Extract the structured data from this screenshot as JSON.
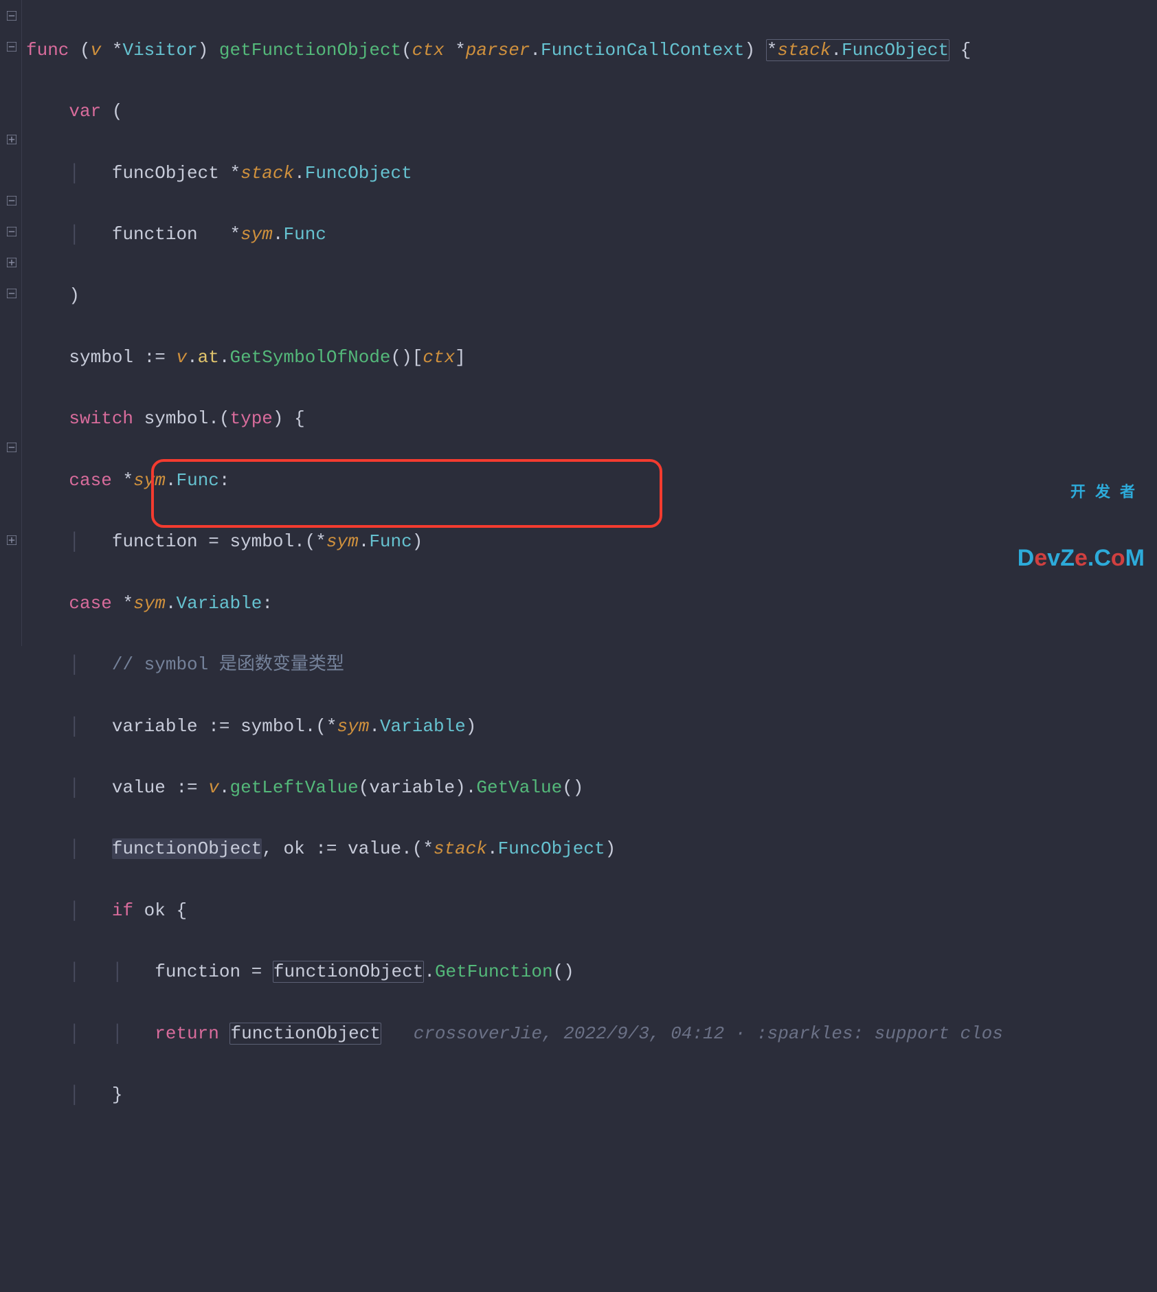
{
  "code": {
    "l1": {
      "kw_func": "func",
      "lparen": " (",
      "recv": "v ",
      "star": "*",
      "recv_type": "Visitor",
      "rparen": ") ",
      "fname": "getFunctionObject",
      "lp2": "(",
      "param": "ctx ",
      "star2": "*",
      "pkg": "parser",
      "dot": ".",
      "ptype": "FunctionCallContext",
      "rp2": ") ",
      "ret_star": "*",
      "ret_pkg": "stack",
      "ret_dot": ".",
      "ret_type": "FuncObject",
      "brace": " {"
    },
    "l2": {
      "kw": "var",
      "paren": " ("
    },
    "l3": {
      "name": "funcObject ",
      "star": "*",
      "pkg": "stack",
      "dot": ".",
      "type": "FuncObject"
    },
    "l4": {
      "name": "function   ",
      "star": "*",
      "pkg": "sym",
      "dot": ".",
      "type": "Func"
    },
    "l5": {
      "paren": ")"
    },
    "l6": {
      "lhs": "symbol := ",
      "v": "v",
      "dot1": ".",
      "at": "at",
      "dot2": ".",
      "method": "GetSymbolOfNode",
      "call": "()[",
      "ctx": "ctx",
      "close": "]"
    },
    "l7": {
      "kw": "switch",
      "sp": " symbol.(",
      "type_kw": "type",
      "rest": ") {"
    },
    "l8": {
      "kw": "case",
      "sp": " ",
      "star": "*",
      "pkg": "sym",
      "dot": ".",
      "type": "Func",
      "colon": ":"
    },
    "l9": {
      "lhs": "function = symbol.(",
      "star": "*",
      "pkg": "sym",
      "dot": ".",
      "type": "Func",
      "rest": ")"
    },
    "l10": {
      "kw": "case",
      "sp": " ",
      "star": "*",
      "pkg": "sym",
      "dot": ".",
      "type": "Variable",
      "colon": ":"
    },
    "l11": {
      "comment": "// symbol 是函数变量类型"
    },
    "l12": {
      "lhs": "variable := symbol.(",
      "star": "*",
      "pkg": "sym",
      "dot": ".",
      "type": "Variable",
      "rest": ")"
    },
    "l13": {
      "lhs": "value := ",
      "v": "v",
      "dot": ".",
      "m1": "getLeftValue",
      "args": "(variable).",
      "m2": "GetValue",
      "call": "()"
    },
    "l14": {
      "fo": "functionObject",
      "mid": ", ok := value.(",
      "star": "*",
      "pkg": "stack",
      "dot": ".",
      "type": "FuncObject",
      "rest": ")"
    },
    "l15": {
      "kw": "if",
      "cond": " ok {"
    },
    "l16": {
      "lhs": "function = ",
      "fo": "functionObject",
      "dot": ".",
      "method": "GetFunction",
      "call": "()"
    },
    "l17": {
      "kw": "return",
      "sp": " ",
      "fo": "functionObject",
      "blame": "   crossoverJie, 2022/9/3, 04:12 · :sparkles: support clos"
    },
    "l18": {
      "brace": "}"
    }
  },
  "watermark": {
    "line1": "开发者",
    "line2a": "D",
    "line2e": "e",
    "line2b": "vZ",
    "line2e2": "e",
    "line2c": ".C",
    "line2o": "o",
    "line2m": "M"
  }
}
